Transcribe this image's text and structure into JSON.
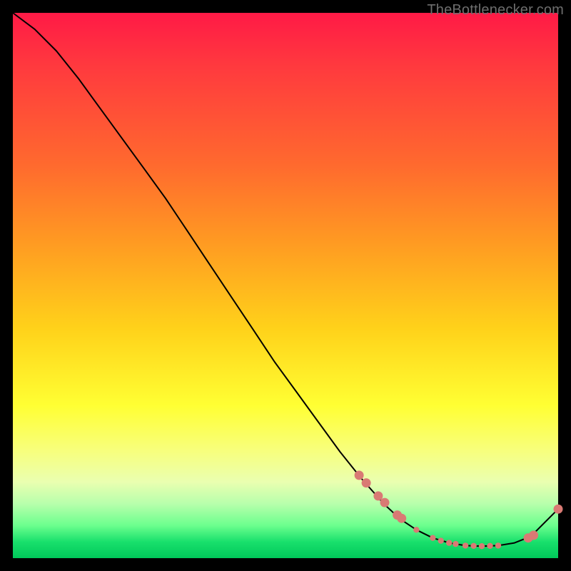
{
  "watermark": "TheBottlenecker.com",
  "chart_data": {
    "type": "line",
    "title": "",
    "xlabel": "",
    "ylabel": "",
    "xlim": [
      0,
      100
    ],
    "ylim": [
      0,
      100
    ],
    "grid": false,
    "note": "Bottleneck-style percentage curve descending from 100% at x≈0 to a minimum near x≈80-90 then rising. Highlighted dots mark the low-bottleneck region.",
    "series": [
      {
        "name": "bottleneck_curve",
        "color": "#000000",
        "x": [
          0,
          4,
          8,
          12,
          16,
          20,
          24,
          28,
          32,
          36,
          40,
          44,
          48,
          52,
          56,
          60,
          64,
          68,
          71,
          74,
          77,
          80,
          83,
          86,
          89,
          92,
          95,
          100
        ],
        "y": [
          100,
          97,
          93,
          88,
          82.5,
          77,
          71.5,
          66,
          60,
          54,
          48,
          42,
          36,
          30.5,
          25,
          19.5,
          14.5,
          10,
          7.2,
          5.2,
          3.7,
          2.8,
          2.3,
          2.2,
          2.3,
          2.8,
          4.0,
          9.0
        ]
      }
    ],
    "highlight_points": {
      "name": "good_fit_markers",
      "color": "#d97a74",
      "radius_large": 6.5,
      "radius_small": 4.2,
      "points": [
        {
          "x": 63.5,
          "y": 15.2,
          "r": "large"
        },
        {
          "x": 64.8,
          "y": 13.8,
          "r": "large"
        },
        {
          "x": 67.0,
          "y": 11.4,
          "r": "large"
        },
        {
          "x": 68.2,
          "y": 10.2,
          "r": "large"
        },
        {
          "x": 70.5,
          "y": 7.9,
          "r": "large"
        },
        {
          "x": 71.3,
          "y": 7.3,
          "r": "large"
        },
        {
          "x": 74.0,
          "y": 5.2,
          "r": "small"
        },
        {
          "x": 77.0,
          "y": 3.7,
          "r": "small"
        },
        {
          "x": 78.5,
          "y": 3.2,
          "r": "small"
        },
        {
          "x": 80.0,
          "y": 2.8,
          "r": "small"
        },
        {
          "x": 81.2,
          "y": 2.6,
          "r": "small"
        },
        {
          "x": 83.0,
          "y": 2.3,
          "r": "small"
        },
        {
          "x": 84.5,
          "y": 2.25,
          "r": "small"
        },
        {
          "x": 86.0,
          "y": 2.2,
          "r": "small"
        },
        {
          "x": 87.5,
          "y": 2.25,
          "r": "small"
        },
        {
          "x": 89.0,
          "y": 2.3,
          "r": "small"
        },
        {
          "x": 94.5,
          "y": 3.7,
          "r": "large"
        },
        {
          "x": 95.5,
          "y": 4.2,
          "r": "large"
        },
        {
          "x": 100.0,
          "y": 9.0,
          "r": "large"
        }
      ]
    }
  }
}
